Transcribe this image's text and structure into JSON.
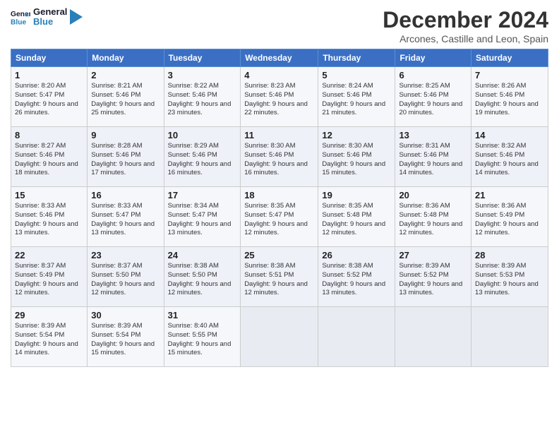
{
  "logo": {
    "text_general": "General",
    "text_blue": "Blue"
  },
  "title": "December 2024",
  "subtitle": "Arcones, Castille and Leon, Spain",
  "header_days": [
    "Sunday",
    "Monday",
    "Tuesday",
    "Wednesday",
    "Thursday",
    "Friday",
    "Saturday"
  ],
  "weeks": [
    [
      {
        "day": "1",
        "sunrise": "Sunrise: 8:20 AM",
        "sunset": "Sunset: 5:47 PM",
        "daylight": "Daylight: 9 hours and 26 minutes."
      },
      {
        "day": "2",
        "sunrise": "Sunrise: 8:21 AM",
        "sunset": "Sunset: 5:46 PM",
        "daylight": "Daylight: 9 hours and 25 minutes."
      },
      {
        "day": "3",
        "sunrise": "Sunrise: 8:22 AM",
        "sunset": "Sunset: 5:46 PM",
        "daylight": "Daylight: 9 hours and 23 minutes."
      },
      {
        "day": "4",
        "sunrise": "Sunrise: 8:23 AM",
        "sunset": "Sunset: 5:46 PM",
        "daylight": "Daylight: 9 hours and 22 minutes."
      },
      {
        "day": "5",
        "sunrise": "Sunrise: 8:24 AM",
        "sunset": "Sunset: 5:46 PM",
        "daylight": "Daylight: 9 hours and 21 minutes."
      },
      {
        "day": "6",
        "sunrise": "Sunrise: 8:25 AM",
        "sunset": "Sunset: 5:46 PM",
        "daylight": "Daylight: 9 hours and 20 minutes."
      },
      {
        "day": "7",
        "sunrise": "Sunrise: 8:26 AM",
        "sunset": "Sunset: 5:46 PM",
        "daylight": "Daylight: 9 hours and 19 minutes."
      }
    ],
    [
      {
        "day": "8",
        "sunrise": "Sunrise: 8:27 AM",
        "sunset": "Sunset: 5:46 PM",
        "daylight": "Daylight: 9 hours and 18 minutes."
      },
      {
        "day": "9",
        "sunrise": "Sunrise: 8:28 AM",
        "sunset": "Sunset: 5:46 PM",
        "daylight": "Daylight: 9 hours and 17 minutes."
      },
      {
        "day": "10",
        "sunrise": "Sunrise: 8:29 AM",
        "sunset": "Sunset: 5:46 PM",
        "daylight": "Daylight: 9 hours and 16 minutes."
      },
      {
        "day": "11",
        "sunrise": "Sunrise: 8:30 AM",
        "sunset": "Sunset: 5:46 PM",
        "daylight": "Daylight: 9 hours and 16 minutes."
      },
      {
        "day": "12",
        "sunrise": "Sunrise: 8:30 AM",
        "sunset": "Sunset: 5:46 PM",
        "daylight": "Daylight: 9 hours and 15 minutes."
      },
      {
        "day": "13",
        "sunrise": "Sunrise: 8:31 AM",
        "sunset": "Sunset: 5:46 PM",
        "daylight": "Daylight: 9 hours and 14 minutes."
      },
      {
        "day": "14",
        "sunrise": "Sunrise: 8:32 AM",
        "sunset": "Sunset: 5:46 PM",
        "daylight": "Daylight: 9 hours and 14 minutes."
      }
    ],
    [
      {
        "day": "15",
        "sunrise": "Sunrise: 8:33 AM",
        "sunset": "Sunset: 5:46 PM",
        "daylight": "Daylight: 9 hours and 13 minutes."
      },
      {
        "day": "16",
        "sunrise": "Sunrise: 8:33 AM",
        "sunset": "Sunset: 5:47 PM",
        "daylight": "Daylight: 9 hours and 13 minutes."
      },
      {
        "day": "17",
        "sunrise": "Sunrise: 8:34 AM",
        "sunset": "Sunset: 5:47 PM",
        "daylight": "Daylight: 9 hours and 13 minutes."
      },
      {
        "day": "18",
        "sunrise": "Sunrise: 8:35 AM",
        "sunset": "Sunset: 5:47 PM",
        "daylight": "Daylight: 9 hours and 12 minutes."
      },
      {
        "day": "19",
        "sunrise": "Sunrise: 8:35 AM",
        "sunset": "Sunset: 5:48 PM",
        "daylight": "Daylight: 9 hours and 12 minutes."
      },
      {
        "day": "20",
        "sunrise": "Sunrise: 8:36 AM",
        "sunset": "Sunset: 5:48 PM",
        "daylight": "Daylight: 9 hours and 12 minutes."
      },
      {
        "day": "21",
        "sunrise": "Sunrise: 8:36 AM",
        "sunset": "Sunset: 5:49 PM",
        "daylight": "Daylight: 9 hours and 12 minutes."
      }
    ],
    [
      {
        "day": "22",
        "sunrise": "Sunrise: 8:37 AM",
        "sunset": "Sunset: 5:49 PM",
        "daylight": "Daylight: 9 hours and 12 minutes."
      },
      {
        "day": "23",
        "sunrise": "Sunrise: 8:37 AM",
        "sunset": "Sunset: 5:50 PM",
        "daylight": "Daylight: 9 hours and 12 minutes."
      },
      {
        "day": "24",
        "sunrise": "Sunrise: 8:38 AM",
        "sunset": "Sunset: 5:50 PM",
        "daylight": "Daylight: 9 hours and 12 minutes."
      },
      {
        "day": "25",
        "sunrise": "Sunrise: 8:38 AM",
        "sunset": "Sunset: 5:51 PM",
        "daylight": "Daylight: 9 hours and 12 minutes."
      },
      {
        "day": "26",
        "sunrise": "Sunrise: 8:38 AM",
        "sunset": "Sunset: 5:52 PM",
        "daylight": "Daylight: 9 hours and 13 minutes."
      },
      {
        "day": "27",
        "sunrise": "Sunrise: 8:39 AM",
        "sunset": "Sunset: 5:52 PM",
        "daylight": "Daylight: 9 hours and 13 minutes."
      },
      {
        "day": "28",
        "sunrise": "Sunrise: 8:39 AM",
        "sunset": "Sunset: 5:53 PM",
        "daylight": "Daylight: 9 hours and 13 minutes."
      }
    ],
    [
      {
        "day": "29",
        "sunrise": "Sunrise: 8:39 AM",
        "sunset": "Sunset: 5:54 PM",
        "daylight": "Daylight: 9 hours and 14 minutes."
      },
      {
        "day": "30",
        "sunrise": "Sunrise: 8:39 AM",
        "sunset": "Sunset: 5:54 PM",
        "daylight": "Daylight: 9 hours and 15 minutes."
      },
      {
        "day": "31",
        "sunrise": "Sunrise: 8:40 AM",
        "sunset": "Sunset: 5:55 PM",
        "daylight": "Daylight: 9 hours and 15 minutes."
      },
      null,
      null,
      null,
      null
    ]
  ]
}
